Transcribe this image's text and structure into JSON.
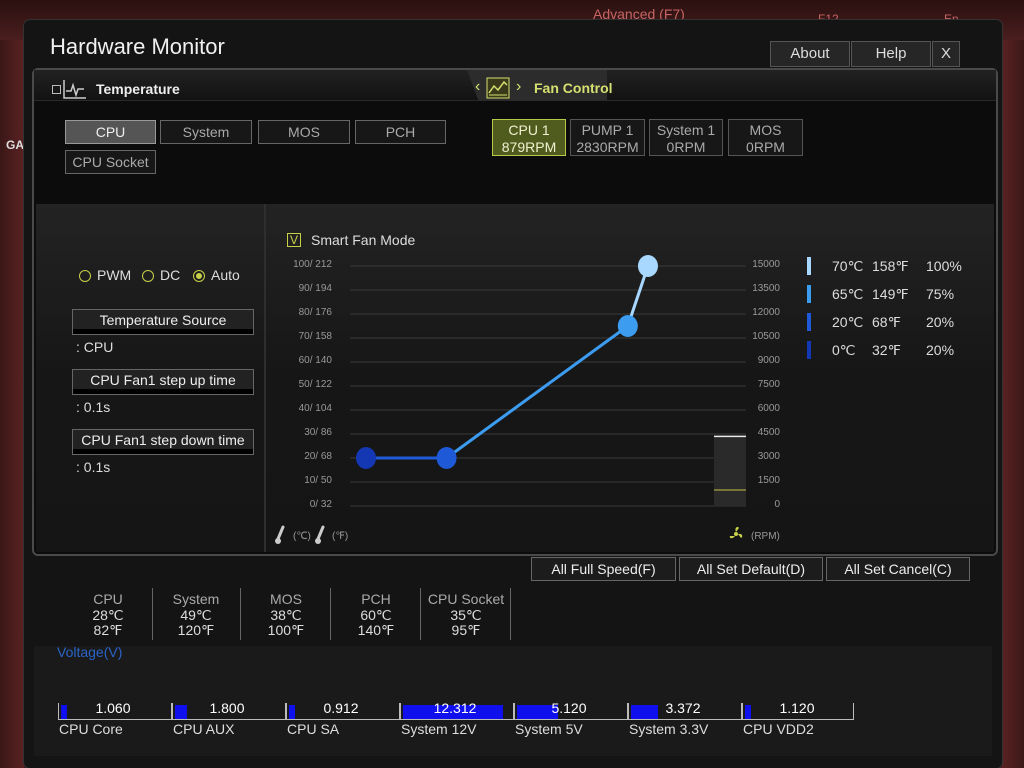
{
  "background": {
    "tab_label": "Advanced (F7)",
    "f12_label": "F12",
    "lang_label": "En",
    "side_label": "GA"
  },
  "window": {
    "title": "Hardware Monitor",
    "about_label": "About",
    "help_label": "Help",
    "close_label": "X"
  },
  "temperature_tab": {
    "label": "Temperature"
  },
  "fan_tab": {
    "label": "Fan Control",
    "prev": "‹",
    "next": "›"
  },
  "sensors": [
    {
      "label": "CPU",
      "active": true
    },
    {
      "label": "System",
      "active": false
    },
    {
      "label": "MOS",
      "active": false
    },
    {
      "label": "PCH",
      "active": false
    },
    {
      "label": "CPU Socket",
      "active": false
    }
  ],
  "fans": [
    {
      "name": "CPU 1",
      "rpm": "879RPM",
      "active": true
    },
    {
      "name": "PUMP 1",
      "rpm": "2830RPM",
      "active": false
    },
    {
      "name": "System 1",
      "rpm": "0RPM",
      "active": false
    },
    {
      "name": "MOS",
      "rpm": "0RPM",
      "active": false
    }
  ],
  "mode": {
    "options": [
      "PWM",
      "DC",
      "Auto"
    ],
    "selected": "Auto"
  },
  "temperature_source": {
    "label": "Temperature Source",
    "value": ": CPU"
  },
  "step_up": {
    "label": "CPU Fan1 step up time",
    "value": ": 0.1s"
  },
  "step_down": {
    "label": "CPU Fan1 step down time",
    "value": ": 0.1s"
  },
  "smart_fan": {
    "label": "Smart Fan Mode",
    "checked": true,
    "check_glyph": "V"
  },
  "chart_data": {
    "type": "line",
    "y_left_ticks": [
      "100/ 212",
      "90/ 194",
      "80/ 176",
      "70/ 158",
      "60/ 140",
      "50/ 122",
      "40/ 104",
      "30/  86",
      "20/  68",
      "10/  50",
      "0/  32"
    ],
    "y_right_ticks": [
      "15000",
      "13500",
      "12000",
      "10500",
      "9000",
      "7500",
      "6000",
      "4500",
      "3000",
      "1500",
      "0"
    ],
    "x_label_celsius": "(℃)",
    "x_label_fahrenheit": "(℉)",
    "rpm_label": "(RPM)",
    "x_range": [
      0,
      100
    ],
    "y_range": [
      0,
      100
    ],
    "curve": [
      {
        "temp_c": 0,
        "percent": 20,
        "color": "#1438b4"
      },
      {
        "temp_c": 20,
        "percent": 20,
        "color": "#1e5ad8"
      },
      {
        "temp_c": 65,
        "percent": 75,
        "color": "#3c9cf0"
      },
      {
        "temp_c": 70,
        "percent": 100,
        "color": "#a8d8ff"
      }
    ],
    "current_level_percent": 29
  },
  "legend": [
    {
      "c": "70℃",
      "f": "158℉",
      "p": "100%",
      "color": "#a8d8ff"
    },
    {
      "c": "65℃",
      "f": "149℉",
      "p": "75%",
      "color": "#3c9cf0"
    },
    {
      "c": "20℃",
      "f": "68℉",
      "p": "20%",
      "color": "#1e5ad8"
    },
    {
      "c": "0℃",
      "f": "32℉",
      "p": "20%",
      "color": "#1438b4"
    }
  ],
  "actions": {
    "full_speed": "All Full Speed(F)",
    "set_default": "All Set Default(D)",
    "set_cancel": "All Set Cancel(C)"
  },
  "temps_summary": [
    {
      "name": "CPU",
      "c": "28℃",
      "f": "82℉"
    },
    {
      "name": "System",
      "c": "49℃",
      "f": "120℉"
    },
    {
      "name": "MOS",
      "c": "38℃",
      "f": "100℉"
    },
    {
      "name": "PCH",
      "c": "60℃",
      "f": "140℉"
    },
    {
      "name": "CPU Socket",
      "c": "35℃",
      "f": "95℉"
    }
  ],
  "voltage": {
    "title": "Voltage(V)",
    "items": [
      {
        "label": "CPU Core",
        "value": "1.060",
        "fill": 0.06
      },
      {
        "label": "CPU AUX",
        "value": "1.800",
        "fill": 0.12
      },
      {
        "label": "CPU SA",
        "value": "0.912",
        "fill": 0.05
      },
      {
        "label": "System 12V",
        "value": "12.312",
        "fill": 1.0
      },
      {
        "label": "System 5V",
        "value": "5.120",
        "fill": 0.41
      },
      {
        "label": "System 3.3V",
        "value": "3.372",
        "fill": 0.27
      },
      {
        "label": "CPU VDD2",
        "value": "1.120",
        "fill": 0.06
      }
    ]
  }
}
